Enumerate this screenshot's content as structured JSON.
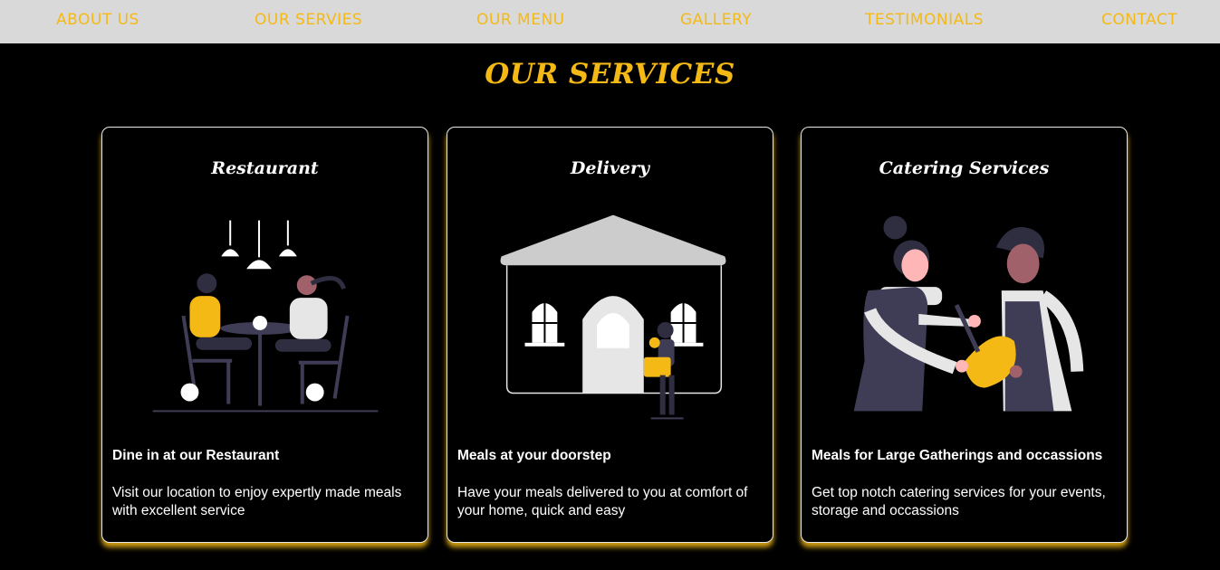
{
  "nav": {
    "items": [
      "ABOUT US",
      "OUR SERVIES",
      "OUR MENU",
      "GALLERY",
      "TESTIMONIALS",
      "CONTACT"
    ]
  },
  "section": {
    "title": "OUR SERVICES"
  },
  "cards": [
    {
      "title": "Restaurant",
      "subtitle": "Dine in at our Restaurant",
      "text": "Visit our location to enjoy expertly made meals with excellent service",
      "illustration": "restaurant-illustration"
    },
    {
      "title": "Delivery",
      "subtitle": "Meals at your doorstep",
      "text": "Have your meals delivered to you at comfort of your home, quick and easy",
      "illustration": "delivery-illustration"
    },
    {
      "title": "Catering Services",
      "subtitle": "Meals for Large Gatherings and occassions",
      "text": "Get top notch catering services for your events, storage and occassions",
      "illustration": "catering-illustration"
    }
  ],
  "colors": {
    "accent": "#f5b915",
    "navbar_bg": "#d9d9d9",
    "page_bg": "#000000",
    "card_border": "#e8e8e8"
  }
}
